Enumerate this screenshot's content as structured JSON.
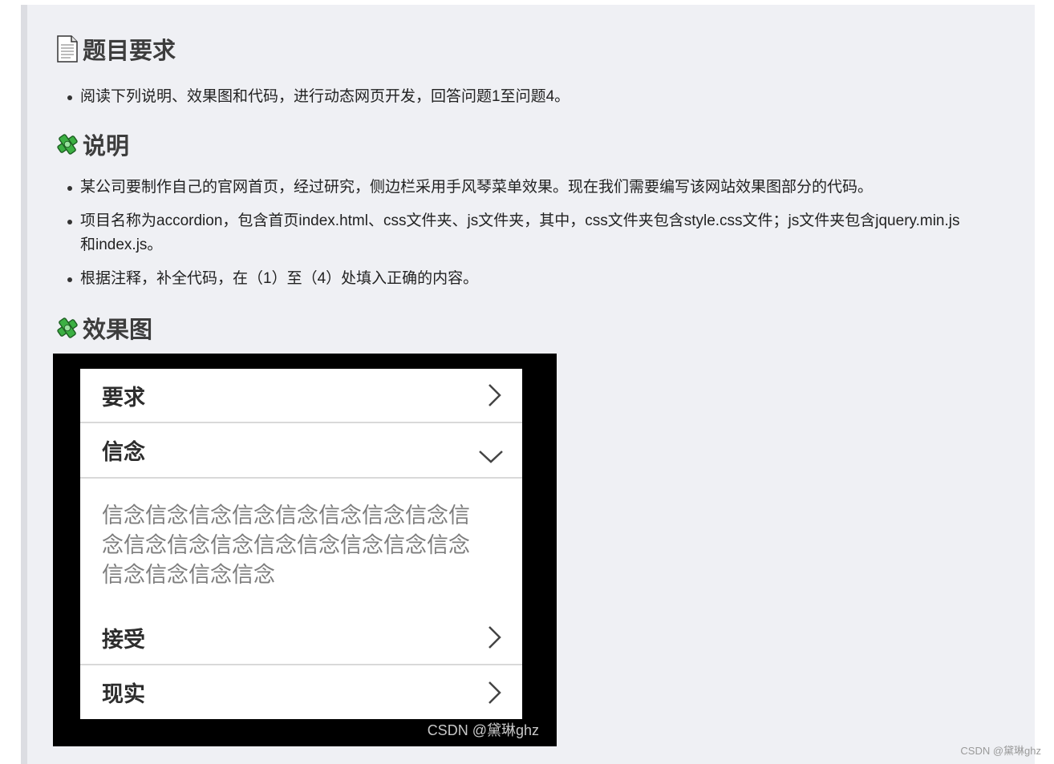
{
  "sections": {
    "requirements": {
      "icon": "document-icon",
      "title": "题目要求",
      "bullets": [
        "阅读下列说明、效果图和代码，进行动态网页开发，回答问题1至问题4。"
      ]
    },
    "description": {
      "icon": "puzzle-icon",
      "title": "说明",
      "bullets": [
        "某公司要制作自己的官网首页，经过研究，侧边栏采用手风琴菜单效果。现在我们需要编写该网站效果图部分的代码。",
        "项目名称为accordion，包含首页index.html、css文件夹、js文件夹，其中，css文件夹包含style.css文件；js文件夹包含jquery.min.js 和index.js。",
        "根据注释，补全代码，在（1）至（4）处填入正确的内容。"
      ]
    },
    "effect": {
      "icon": "puzzle-icon",
      "title": "效果图"
    }
  },
  "accordion": {
    "items": [
      {
        "label": "要求",
        "state": "collapsed",
        "icon": "chevron-right-icon"
      },
      {
        "label": "信念",
        "state": "expanded",
        "icon": "chevron-down-icon"
      },
      {
        "label": "接受",
        "state": "collapsed",
        "icon": "chevron-right-icon"
      },
      {
        "label": "现实",
        "state": "collapsed",
        "icon": "chevron-right-icon"
      }
    ],
    "expanded_content": "信念信念信念信念信念信念信念信念信念信念信念信念信念信念信念信念信念信念信念信念信念",
    "watermark": "CSDN @黛琳ghz"
  },
  "page_watermark": "CSDN @黛琳ghz",
  "colors": {
    "quote_background": "#eff0f4",
    "quote_border": "#dcdde2",
    "preview_background": "#000000",
    "accordion_text": "#2d2d2d",
    "content_text": "#7d7d7d"
  }
}
